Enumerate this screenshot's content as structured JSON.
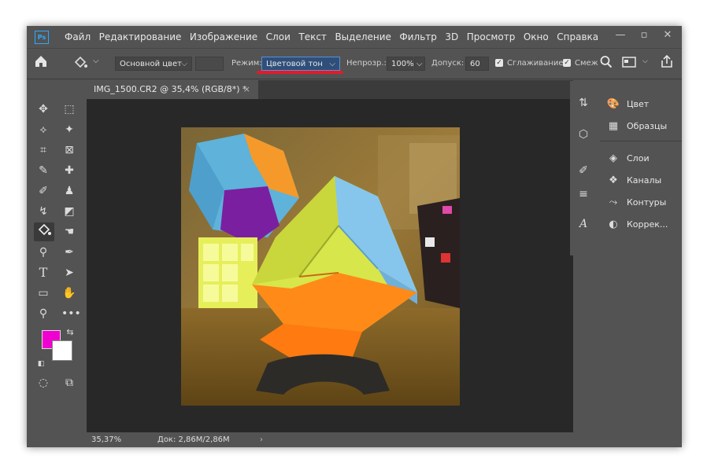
{
  "app": {
    "logo": "Ps"
  },
  "menu": [
    "Файл",
    "Редактирование",
    "Изображение",
    "Слои",
    "Текст",
    "Выделение",
    "Фильтр",
    "3D",
    "Просмотр",
    "Окно",
    "Справка"
  ],
  "options": {
    "fill_source": "Основной цвет",
    "mode_label": "Режим:",
    "mode_value": "Цветовой тон",
    "opacity_label": "Непрозр.:",
    "opacity_value": "100%",
    "tolerance_label": "Допуск:",
    "tolerance_value": "60",
    "antialias_label": "Сглаживание",
    "contiguous_label": "Смеж"
  },
  "document": {
    "tab_title": "IMG_1500.CR2 @ 35,4% (RGB/8*) *",
    "tab_close": "×"
  },
  "status": {
    "zoom": "35,37%",
    "doc_info": "Док: 2,86M/2,86M"
  },
  "colors": {
    "foreground": "#f000d0",
    "background": "#ffffff",
    "accent_underline": "#e21b2b"
  },
  "panels": [
    {
      "label": "Цвет",
      "icon": "palette-icon"
    },
    {
      "label": "Образцы",
      "icon": "grid-icon"
    },
    {
      "label": "Слои",
      "icon": "layers-icon"
    },
    {
      "label": "Каналы",
      "icon": "channels-icon"
    },
    {
      "label": "Контуры",
      "icon": "paths-icon"
    },
    {
      "label": "Коррек...",
      "icon": "adjustments-icon"
    }
  ]
}
